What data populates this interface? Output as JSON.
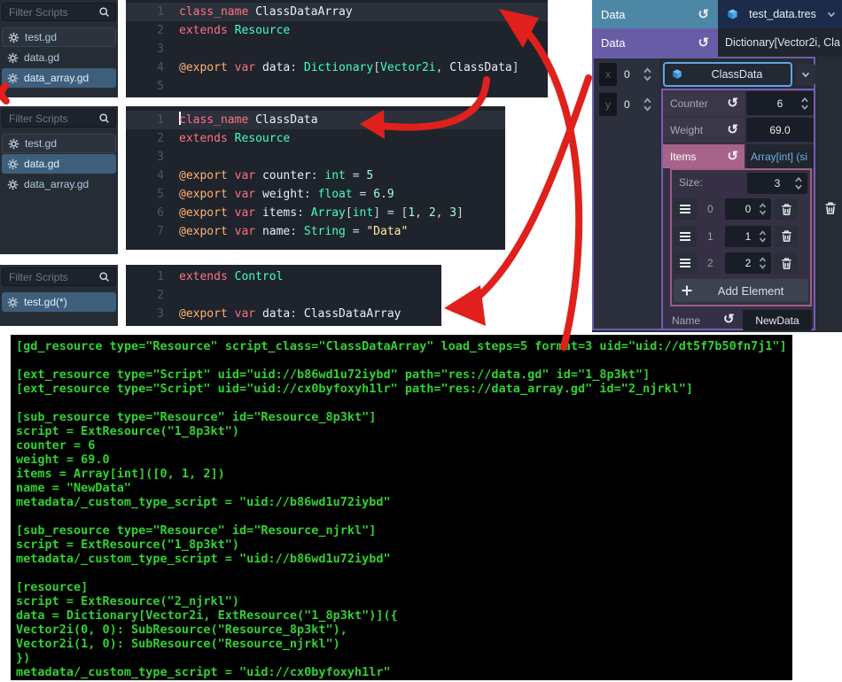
{
  "colors": {
    "arrow_red": "#e0201c",
    "header_teal": "#4d87a6",
    "header_purple": "#685ca6",
    "selected_file_bg": "#3d5f7b",
    "resource_border_blue": "#5ea6e2",
    "subresource_border_purple": "#7a5cb5",
    "array_border_pink": "#a05e84",
    "items_row_pink": "#a7648a",
    "terminal_green": "#32d132",
    "link_blue": "#6fb1e2"
  },
  "script_panels": [
    {
      "filter_placeholder": "Filter Scripts",
      "files": [
        {
          "label": "test.gd",
          "state": "boxed"
        },
        {
          "label": "data.gd",
          "state": "plain"
        },
        {
          "label": "data_array.gd",
          "state": "selected"
        }
      ]
    },
    {
      "filter_placeholder": "Filter Scripts",
      "files": [
        {
          "label": "test.gd",
          "state": "boxed"
        },
        {
          "label": "data.gd",
          "state": "selected"
        },
        {
          "label": "data_array.gd",
          "state": "plain"
        }
      ]
    },
    {
      "filter_placeholder": "Filter Scripts",
      "files": [
        {
          "label": "test.gd(*)",
          "state": "selected"
        }
      ]
    }
  ],
  "editors": [
    {
      "lines": [
        {
          "hl": true,
          "toks": [
            [
              "class_name",
              "kw"
            ],
            [
              " ",
              "sp"
            ],
            [
              "ClassDataArray",
              "id"
            ]
          ]
        },
        {
          "toks": [
            [
              "extends",
              "kw"
            ],
            [
              " ",
              "sp"
            ],
            [
              "Resource",
              "typ"
            ]
          ]
        },
        {
          "toks": []
        },
        {
          "toks": [
            [
              "@export",
              "ann"
            ],
            [
              " ",
              "sp"
            ],
            [
              "var",
              "kw"
            ],
            [
              " ",
              "sp"
            ],
            [
              "data",
              "id"
            ],
            [
              ": ",
              "pun"
            ],
            [
              "Dictionary",
              "typ"
            ],
            [
              "[",
              "pun"
            ],
            [
              "Vector2i",
              "typ"
            ],
            [
              ", ",
              "pun"
            ],
            [
              "ClassData",
              "id"
            ],
            [
              "]",
              "pun"
            ]
          ]
        },
        {
          "toks": []
        }
      ]
    },
    {
      "lines": [
        {
          "hl": true,
          "caret": true,
          "toks": [
            [
              "class_name",
              "kw"
            ],
            [
              " ",
              "sp"
            ],
            [
              "ClassData",
              "id"
            ]
          ]
        },
        {
          "toks": [
            [
              "extends",
              "kw"
            ],
            [
              " ",
              "sp"
            ],
            [
              "Resource",
              "typ"
            ]
          ]
        },
        {
          "toks": []
        },
        {
          "toks": [
            [
              "@export",
              "ann"
            ],
            [
              " ",
              "sp"
            ],
            [
              "var",
              "kw"
            ],
            [
              " ",
              "sp"
            ],
            [
              "counter",
              "id"
            ],
            [
              ": ",
              "pun"
            ],
            [
              "int",
              "typ"
            ],
            [
              " = ",
              "pun"
            ],
            [
              "5",
              "num"
            ]
          ]
        },
        {
          "toks": [
            [
              "@export",
              "ann"
            ],
            [
              " ",
              "sp"
            ],
            [
              "var",
              "kw"
            ],
            [
              " ",
              "sp"
            ],
            [
              "weight",
              "id"
            ],
            [
              ": ",
              "pun"
            ],
            [
              "float",
              "typ"
            ],
            [
              " = ",
              "pun"
            ],
            [
              "6.9",
              "num"
            ]
          ]
        },
        {
          "toks": [
            [
              "@export",
              "ann"
            ],
            [
              " ",
              "sp"
            ],
            [
              "var",
              "kw"
            ],
            [
              " ",
              "sp"
            ],
            [
              "items",
              "id"
            ],
            [
              ": ",
              "pun"
            ],
            [
              "Array",
              "typ"
            ],
            [
              "[",
              "pun"
            ],
            [
              "int",
              "typ"
            ],
            [
              "]",
              "pun"
            ],
            [
              " = ",
              "pun"
            ],
            [
              "[",
              "pun"
            ],
            [
              "1",
              "num"
            ],
            [
              ", ",
              "pun"
            ],
            [
              "2",
              "num"
            ],
            [
              ", ",
              "pun"
            ],
            [
              "3",
              "num"
            ],
            [
              "]",
              "pun"
            ]
          ]
        },
        {
          "toks": [
            [
              "@export",
              "ann"
            ],
            [
              " ",
              "sp"
            ],
            [
              "var",
              "kw"
            ],
            [
              " ",
              "sp"
            ],
            [
              "name",
              "id"
            ],
            [
              ": ",
              "pun"
            ],
            [
              "String",
              "typ"
            ],
            [
              " = ",
              "pun"
            ],
            [
              "\"Data\"",
              "str"
            ]
          ]
        }
      ]
    },
    {
      "lines": [
        {
          "toks": [
            [
              "extends",
              "kw"
            ],
            [
              " ",
              "sp"
            ],
            [
              "Control",
              "typ"
            ]
          ]
        },
        {
          "toks": []
        },
        {
          "toks": [
            [
              "@export",
              "ann"
            ],
            [
              " ",
              "sp"
            ],
            [
              "var",
              "kw"
            ],
            [
              " ",
              "sp"
            ],
            [
              "data",
              "id"
            ],
            [
              ": ",
              "pun"
            ],
            [
              "ClassDataArray",
              "id"
            ]
          ]
        }
      ]
    }
  ],
  "inspector": {
    "header1": {
      "label": "Data",
      "resource": "test_data.tres"
    },
    "header2": {
      "label": "Data",
      "type": "Dictionary[Vector2i, Cla"
    },
    "key": {
      "x_label": "x",
      "x_value": "0",
      "y_label": "y",
      "y_value": "0"
    },
    "value_resource": "ClassData",
    "counter_label": "Counter",
    "counter_value": "6",
    "weight_label": "Weight",
    "weight_value": "69.0",
    "items_label": "Items",
    "items_type": "Array[int] (si",
    "size_label": "Size:",
    "size_value": "3",
    "elements": [
      {
        "index": "0",
        "value": "0"
      },
      {
        "index": "1",
        "value": "1"
      },
      {
        "index": "2",
        "value": "2"
      }
    ],
    "add_element_label": "Add Element",
    "name_label": "Name",
    "name_value": "NewData"
  },
  "terminal": {
    "lines": [
      "[gd_resource type=\"Resource\" script_class=\"ClassDataArray\" load_steps=5 format=3 uid=\"uid://dt5f7b50fn7j1\"]",
      "",
      "[ext_resource type=\"Script\" uid=\"uid://b86wd1u72iybd\" path=\"res://data.gd\" id=\"1_8p3kt\"]",
      "[ext_resource type=\"Script\" uid=\"uid://cx0byfoxyh1lr\" path=\"res://data_array.gd\" id=\"2_njrkl\"]",
      "",
      "[sub_resource type=\"Resource\" id=\"Resource_8p3kt\"]",
      "script = ExtResource(\"1_8p3kt\")",
      "counter = 6",
      "weight = 69.0",
      "items = Array[int]([0, 1, 2])",
      "name = \"NewData\"",
      "metadata/_custom_type_script = \"uid://b86wd1u72iybd\"",
      "",
      "[sub_resource type=\"Resource\" id=\"Resource_njrkl\"]",
      "script = ExtResource(\"1_8p3kt\")",
      "metadata/_custom_type_script = \"uid://b86wd1u72iybd\"",
      "",
      "[resource]",
      "script = ExtResource(\"2_njrkl\")",
      "data = Dictionary[Vector2i, ExtResource(\"1_8p3kt\")]({",
      "Vector2i(0, 0): SubResource(\"Resource_8p3kt\"),",
      "Vector2i(1, 0): SubResource(\"Resource_njrkl\")",
      "})",
      "metadata/_custom_type_script = \"uid://cx0byfoxyh1lr\""
    ]
  }
}
